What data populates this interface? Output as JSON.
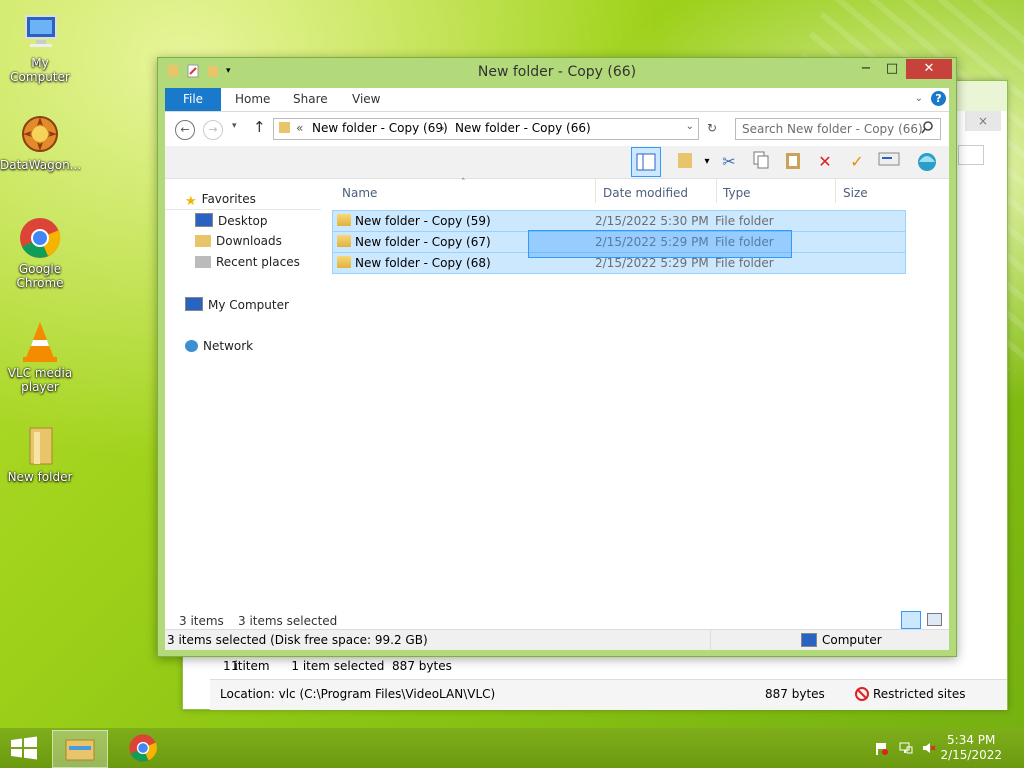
{
  "desktop": {
    "icons": [
      {
        "label": "My Computer"
      },
      {
        "label": "DataWagon..."
      },
      {
        "label": "Google Chrome"
      },
      {
        "label": "VLC media player"
      },
      {
        "label": "New folder"
      }
    ]
  },
  "back_window": {
    "status_items": "1 it",
    "status_count": "1 item",
    "status_selected": "1 item selected  887 bytes",
    "location": "Location: vlc (C:\\Program Files\\VideoLAN\\VLC)",
    "size": "887 bytes",
    "zone": "Restricted sites",
    "close_glyph": "×"
  },
  "window": {
    "title": "New folder - Copy (66)",
    "tabs": [
      "File",
      "Home",
      "Share",
      "View"
    ],
    "address": {
      "prefix": "«",
      "crumbs": [
        "New folder - Copy (69)",
        "New folder - Copy (66)"
      ],
      "separator": "›"
    },
    "search_placeholder": "Search New folder - Copy (66)",
    "columns": [
      "Name",
      "Date modified",
      "Type",
      "Size"
    ],
    "rows": [
      {
        "name": "New folder - Copy (59)",
        "date": "2/15/2022 5:30 PM",
        "type": "File folder"
      },
      {
        "name": "New folder - Copy (67)",
        "date": "2/15/2022 5:29 PM",
        "type": "File folder"
      },
      {
        "name": "New folder - Copy (68)",
        "date": "2/15/2022 5:29 PM",
        "type": "File folder"
      }
    ],
    "nav": {
      "favorites": "Favorites",
      "desktop": "Desktop",
      "downloads": "Downloads",
      "recent": "Recent places",
      "computer": "My Computer",
      "network": "Network"
    },
    "item_count": "3 items",
    "selected_count": "3 items selected",
    "status_left": "3 items selected (Disk free space: 99.2 GB)",
    "status_right": "Computer",
    "caption": {
      "minimize": "−",
      "maximize": "□",
      "close": "✕"
    }
  },
  "taskbar": {
    "time": "5:34 PM",
    "date": "2/15/2022"
  },
  "colors": {
    "accent": "#1979ca",
    "selection": "#cce8ff",
    "desktop": "#9fd21a"
  }
}
